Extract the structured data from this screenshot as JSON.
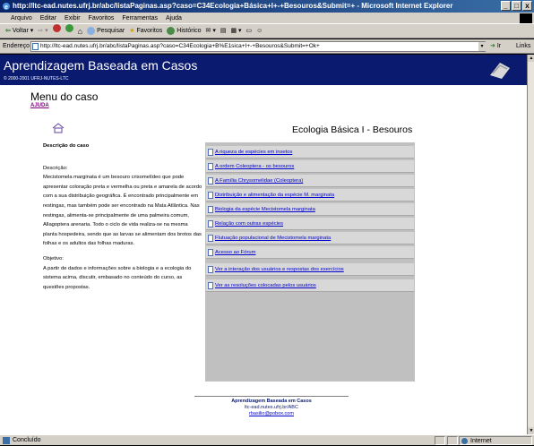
{
  "window": {
    "title": "http://ltc-ead.nutes.ufrj.br/abc/listaPaginas.asp?caso=C34Ecologia+Básica+I+-+Besouros&Submit=+ - Microsoft Internet Explorer",
    "min": "_",
    "max": "□",
    "close": "x"
  },
  "menubar": [
    "Arquivo",
    "Editar",
    "Exibir",
    "Favoritos",
    "Ferramentas",
    "Ajuda"
  ],
  "toolbar": {
    "back": "Voltar",
    "search": "Pesquisar",
    "favorites": "Favoritos",
    "history": "Histórico"
  },
  "address": {
    "label": "Endereço",
    "url": "http://ltc-ead.nutes.ufrj.br/abc/listaPaginas.asp?caso=C34Ecologia+B%E1sica+I+-+Besouros&Submit=+Ok+",
    "go": "Ir",
    "links": "Links"
  },
  "banner": {
    "title": "Aprendizagem Baseada em Casos",
    "subtitle": "© 2000-2001 UFRJ-NUTES-LTC"
  },
  "page": {
    "menu_title": "Menu do caso",
    "help_link": "AJUDA",
    "heading": "Ecologia Básica I - Besouros"
  },
  "description": {
    "header": "Descrição do caso",
    "desc_label": "Descrição:",
    "desc_text": "Mecistomela marginata é um besouro crisomelídeo que pode apresentar coloração preta e vermelha ou preta e amarela de acordo com a sua distribuição geográfica. É encontrado principalmente em restingas, mas também pode ser encontrado na Mata Atlântica. Nas restingas, alimenta-se principalmente de uma palmeira comum, Allagoptera arenaria. Todo o ciclo de vida realiza-se na mesma planta hospedeira, sendo que as larvas se alimentam dos brotos das folhas e os adultos das folhas maduras.",
    "obj_label": "Objetivo:",
    "obj_text": "A partir de dados e informações sobre a biologia e a ecologia do sistema acima, discutir, embasado no conteúdo do curso, as questões propostas."
  },
  "links": [
    "A riqueza de espécies em insetos",
    "A ordem Coleoptera - os besouros",
    "A Família Chrysomelidae (Coleoptera)",
    "Distribuição e alimentação da espécie M. marginata",
    "Biologia da espécie Mecistomela marginata",
    "Relação com outras espécies",
    "Flutuação populacional de Mecistomela marginata",
    "Acesso ao Fórum",
    "Ver a interação dos usuários e respostas dos exercícios",
    "Ver as resoluções colocadas pelos usuários"
  ],
  "footer": {
    "title": "Aprendizagem Baseada em Casos",
    "url": "ltc-ead.nutes.ufrj.br/ABC",
    "email": "rbasilio@pobox.com"
  },
  "status": {
    "text": "Concluído",
    "zone": "Internet"
  },
  "colors": {
    "banner": "#0a1a6e",
    "link": "#0000cc",
    "visited": "#800080",
    "panel": "#c0c0c0",
    "chrome": "#d4d0c8"
  }
}
